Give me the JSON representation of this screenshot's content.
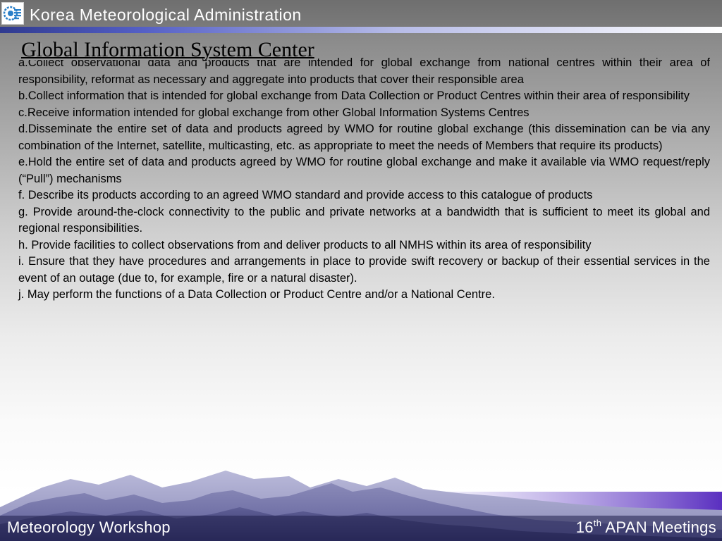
{
  "header": {
    "organization": "Korea Meteorological Administration",
    "logo_icon": "kma-logo-icon"
  },
  "slide": {
    "title": "Global Information System Center",
    "items": [
      "a.Collect observational data and products that are intended for global exchange from national centres within their area of responsibility, reformat as necessary and aggregate into products that cover their responsible area",
      "b.Collect information that is intended for global exchange from Data Collection or Product Centres within their area of responsibility",
      "c.Receive information intended for global exchange from other Global Information Systems Centres",
      "d.Disseminate the entire set of data and products agreed by WMO for routine global exchange (this dissemination can be via any combination of the Internet, satellite, multicasting, etc. as appropriate to meet the needs of Members that require its products)",
      "e.Hold the entire set of data and products agreed by WMO for routine global exchange and make it available via WMO request/reply (“Pull”) mechanisms",
      "f. Describe its products according to an agreed WMO standard and provide access to this catalogue of products",
      "g. Provide around-the-clock connectivity to the public and private networks at a bandwidth that is sufficient to meet its global and regional responsibilities.",
      "h. Provide facilities to collect observations from and deliver products to all NMHS within its area of responsibility",
      "i. Ensure that they have procedures and arrangements in place to provide swift recovery or backup of their essential services in the event of an outage (due to, for example, fire or a natural disaster).",
      "j.  May perform the functions of a Data Collection or Product Centre and/or a National Centre."
    ]
  },
  "footer": {
    "left": "Meteorology Workshop",
    "right_number": "16",
    "right_superscript": "th",
    "right_text": " APAN Meetings"
  },
  "colors": {
    "header_bar": "#777777",
    "accent_blue": "#2f3a8f",
    "mountain_dark": "#46467e",
    "mountain_light": "#8a8ab8",
    "footer_purple": "#5a2fc0"
  }
}
